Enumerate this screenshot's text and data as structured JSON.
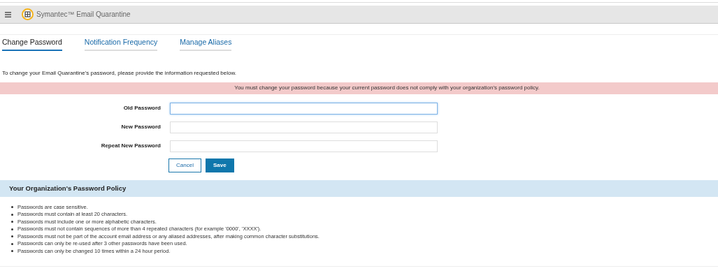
{
  "header": {
    "title": "Symantec™ Email Quarantine"
  },
  "tabs": [
    {
      "label": "Change Password",
      "selected": true
    },
    {
      "label": "Notification Frequency",
      "selected": false
    },
    {
      "label": "Manage Aliases",
      "selected": false
    }
  ],
  "intro": "To change your Email Quarantine's password, please provide the information requested below.",
  "alert": "You must change your password because your current password does not comply with your organization's password policy.",
  "fields": [
    {
      "label": "Old Password",
      "focused": true
    },
    {
      "label": "New Password",
      "focused": false
    },
    {
      "label": "Repeat New Password",
      "focused": false
    }
  ],
  "buttons": [
    {
      "label": "Cancel",
      "kind": "secondary"
    },
    {
      "label": "Save",
      "kind": "primary"
    }
  ],
  "policy": {
    "title": "Your Organization's Password Policy",
    "items": [
      "Passwords are case sensitive.",
      "Passwords must contain at least 20 characters.",
      "Passwords must include one or more alphabetic characters.",
      "Passwords must not contain sequences of more than 4 repeated characters (for example '0000', 'XXXX').",
      "Passwords must not be part of the account email address or any aliased addresses, after making common character substitutions.",
      "Passwords can only be re-used after 3 other passwords have been used.",
      "Passwords can only be changed 10 times within a 24 hour period."
    ]
  }
}
